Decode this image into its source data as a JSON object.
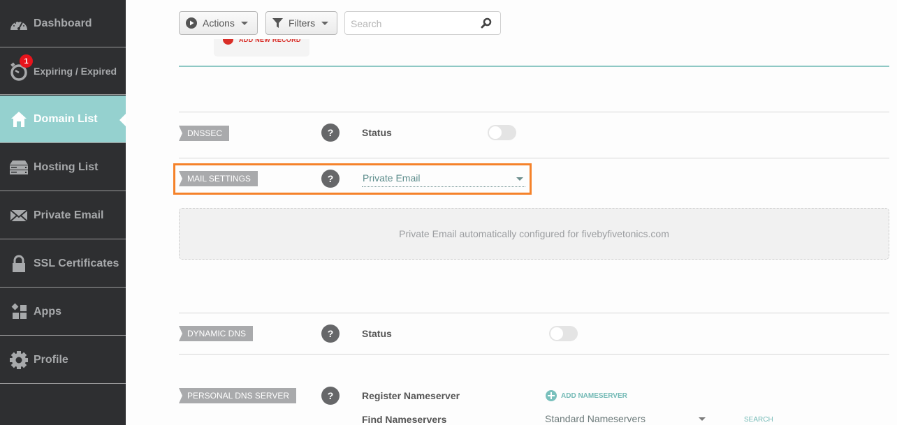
{
  "sidebar": {
    "items": [
      {
        "label": "Dashboard",
        "icon": "dashboard-gauge-icon"
      },
      {
        "label": "Expiring / Expired",
        "icon": "stopwatch-icon",
        "badge": "1"
      },
      {
        "label": "Domain List",
        "icon": "home-icon",
        "active": true
      },
      {
        "label": "Hosting List",
        "icon": "server-icon"
      },
      {
        "label": "Private Email",
        "icon": "envelope-icon"
      },
      {
        "label": "SSL Certificates",
        "icon": "lock-icon"
      },
      {
        "label": "Apps",
        "icon": "apps-icon"
      },
      {
        "label": "Profile",
        "icon": "gear-icon"
      }
    ]
  },
  "toolbar": {
    "actions_label": "Actions",
    "filters_label": "Filters",
    "search_placeholder": "Search",
    "search_value": ""
  },
  "add_record_label": "ADD NEW RECORD",
  "sections": {
    "dnssec": {
      "tag": "DNSSEC",
      "help": "?",
      "field_label": "Status",
      "toggle_on": false
    },
    "mail": {
      "tag": "MAIL SETTINGS",
      "help": "?",
      "selected": "Private Email",
      "info": "Private Email automatically configured for fivebyfivetonics.com"
    },
    "dynamic_dns": {
      "tag": "DYNAMIC DNS",
      "help": "?",
      "field_label": "Status",
      "toggle_on": false
    },
    "personal_dns": {
      "tag": "PERSONAL DNS SERVER",
      "help": "?",
      "register_label": "Register Nameserver",
      "add_nameserver_label": "ADD NAMESERVER",
      "find_label": "Find Nameservers",
      "find_selected": "Standard Nameservers",
      "search_label": "SEARCH"
    }
  },
  "colors": {
    "sidebar_bg": "#2e2f31",
    "active_accent": "#95d1cf",
    "highlight": "#f5822a",
    "badge": "#e8141c"
  }
}
